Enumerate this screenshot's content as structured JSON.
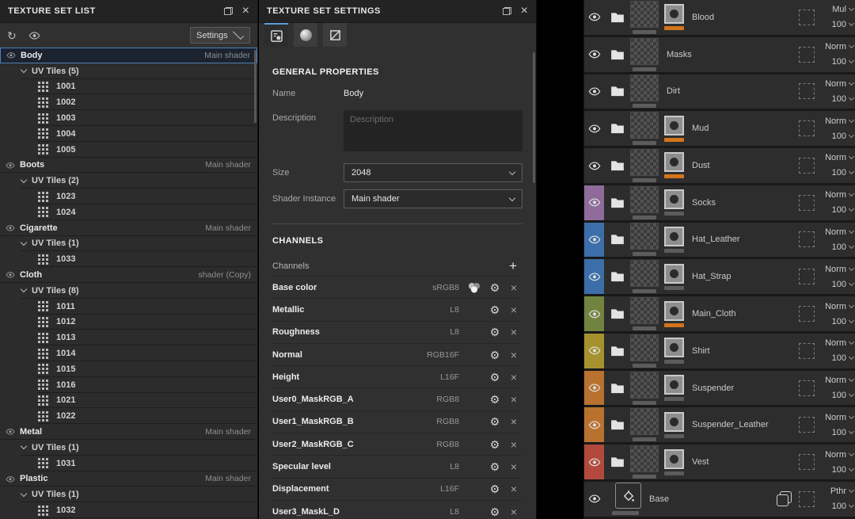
{
  "colors": {
    "accent_blue": "#4c80bd",
    "tab_accent": "#5a9fd8",
    "orange_bar": "#d2751c",
    "gray_bar": "#5c5c5c"
  },
  "texture_set_list": {
    "title": "TEXTURE SET LIST",
    "toolbar": {
      "sync_icon": "circular-arrow",
      "visibility_icon": "eye",
      "settings_label": "Settings"
    },
    "sets": [
      {
        "name": "Body",
        "shader": "Main shader",
        "uv_label": "UV Tiles (5)",
        "selected": true,
        "tiles": [
          "1001",
          "1002",
          "1003",
          "1004",
          "1005"
        ]
      },
      {
        "name": "Boots",
        "shader": "Main shader",
        "uv_label": "UV Tiles (2)",
        "tiles": [
          "1023",
          "1024"
        ]
      },
      {
        "name": "Cigarette",
        "shader": "Main shader",
        "uv_label": "UV Tiles (1)",
        "tiles": [
          "1033"
        ]
      },
      {
        "name": "Cloth",
        "shader": "shader (Copy)",
        "uv_label": "UV Tiles (8)",
        "tiles": [
          "1011",
          "1012",
          "1013",
          "1014",
          "1015",
          "1016",
          "1021",
          "1022"
        ]
      },
      {
        "name": "Metal",
        "shader": "Main shader",
        "uv_label": "UV Tiles (1)",
        "tiles": [
          "1031"
        ]
      },
      {
        "name": "Plastic",
        "shader": "Main shader",
        "uv_label": "UV Tiles (1)",
        "tiles": [
          "1032"
        ]
      }
    ]
  },
  "texture_set_settings": {
    "title": "TEXTURE SET SETTINGS",
    "tabs": [
      "settings-tab",
      "material-sphere-tab",
      "uv-tab"
    ],
    "general_header": "GENERAL PROPERTIES",
    "name_label": "Name",
    "name_value": "Body",
    "description_label": "Description",
    "description_placeholder": "Description",
    "size_label": "Size",
    "size_value": "2048",
    "shader_label": "Shader Instance",
    "shader_value": "Main shader",
    "channels_header": "CHANNELS",
    "channels_label": "Channels",
    "add_channel_label": "+",
    "channels": [
      {
        "name": "Base color",
        "format": "sRGB8",
        "color_icon": true
      },
      {
        "name": "Metallic",
        "format": "L8"
      },
      {
        "name": "Roughness",
        "format": "L8"
      },
      {
        "name": "Normal",
        "format": "RGB16F"
      },
      {
        "name": "Height",
        "format": "L16F"
      },
      {
        "name": "User0_MaskRGB_A",
        "format": "RGB8"
      },
      {
        "name": "User1_MaskRGB_B",
        "format": "RGB8"
      },
      {
        "name": "User2_MaskRGB_C",
        "format": "RGB8"
      },
      {
        "name": "Specular level",
        "format": "L8"
      },
      {
        "name": "Displacement",
        "format": "L16F"
      },
      {
        "name": "User3_MaskL_D",
        "format": "L8"
      }
    ]
  },
  "layers_panel": {
    "layers": [
      {
        "name": "Blood",
        "blend": "Mul",
        "opacity": "100",
        "tag": null,
        "mask": true,
        "mask_bar": "orange"
      },
      {
        "name": "Masks",
        "blend": "Norm",
        "opacity": "100",
        "tag": null,
        "mask": false
      },
      {
        "name": "Dirt",
        "blend": "Norm",
        "opacity": "100",
        "tag": null,
        "mask": false
      },
      {
        "name": "Mud",
        "blend": "Norm",
        "opacity": "100",
        "tag": null,
        "mask": true,
        "mask_bar": "orange"
      },
      {
        "name": "Dust",
        "blend": "Norm",
        "opacity": "100",
        "tag": null,
        "mask": true,
        "mask_bar": "orange"
      },
      {
        "name": "Socks",
        "blend": "Norm",
        "opacity": "100",
        "tag": "#8e6b99",
        "mask": true,
        "mask_bar": "gray"
      },
      {
        "name": "Hat_Leather",
        "blend": "Norm",
        "opacity": "100",
        "tag": "#3c6fa9",
        "mask": true,
        "mask_bar": "gray"
      },
      {
        "name": "Hat_Strap",
        "blend": "Norm",
        "opacity": "100",
        "tag": "#3c6fa9",
        "mask": true,
        "mask_bar": "gray"
      },
      {
        "name": "Main_Cloth",
        "blend": "Norm",
        "opacity": "100",
        "tag": "#71833f",
        "mask": true,
        "mask_bar": "orange"
      },
      {
        "name": "Shirt",
        "blend": "Norm",
        "opacity": "100",
        "tag": "#a5922f",
        "mask": true,
        "mask_bar": "gray"
      },
      {
        "name": "Suspender",
        "blend": "Norm",
        "opacity": "100",
        "tag": "#b9712f",
        "mask": true,
        "mask_bar": "gray"
      },
      {
        "name": "Suspender_Leather",
        "blend": "Norm",
        "opacity": "100",
        "tag": "#b9712f",
        "mask": true,
        "mask_bar": "gray"
      },
      {
        "name": "Vest",
        "blend": "Norm",
        "opacity": "100",
        "tag": "#b14a3c",
        "mask": true,
        "mask_bar": "gray"
      },
      {
        "name": "Base",
        "blend": "Pthr",
        "opacity": "100",
        "tag": null,
        "type": "fill",
        "instance_icon": true
      }
    ]
  }
}
